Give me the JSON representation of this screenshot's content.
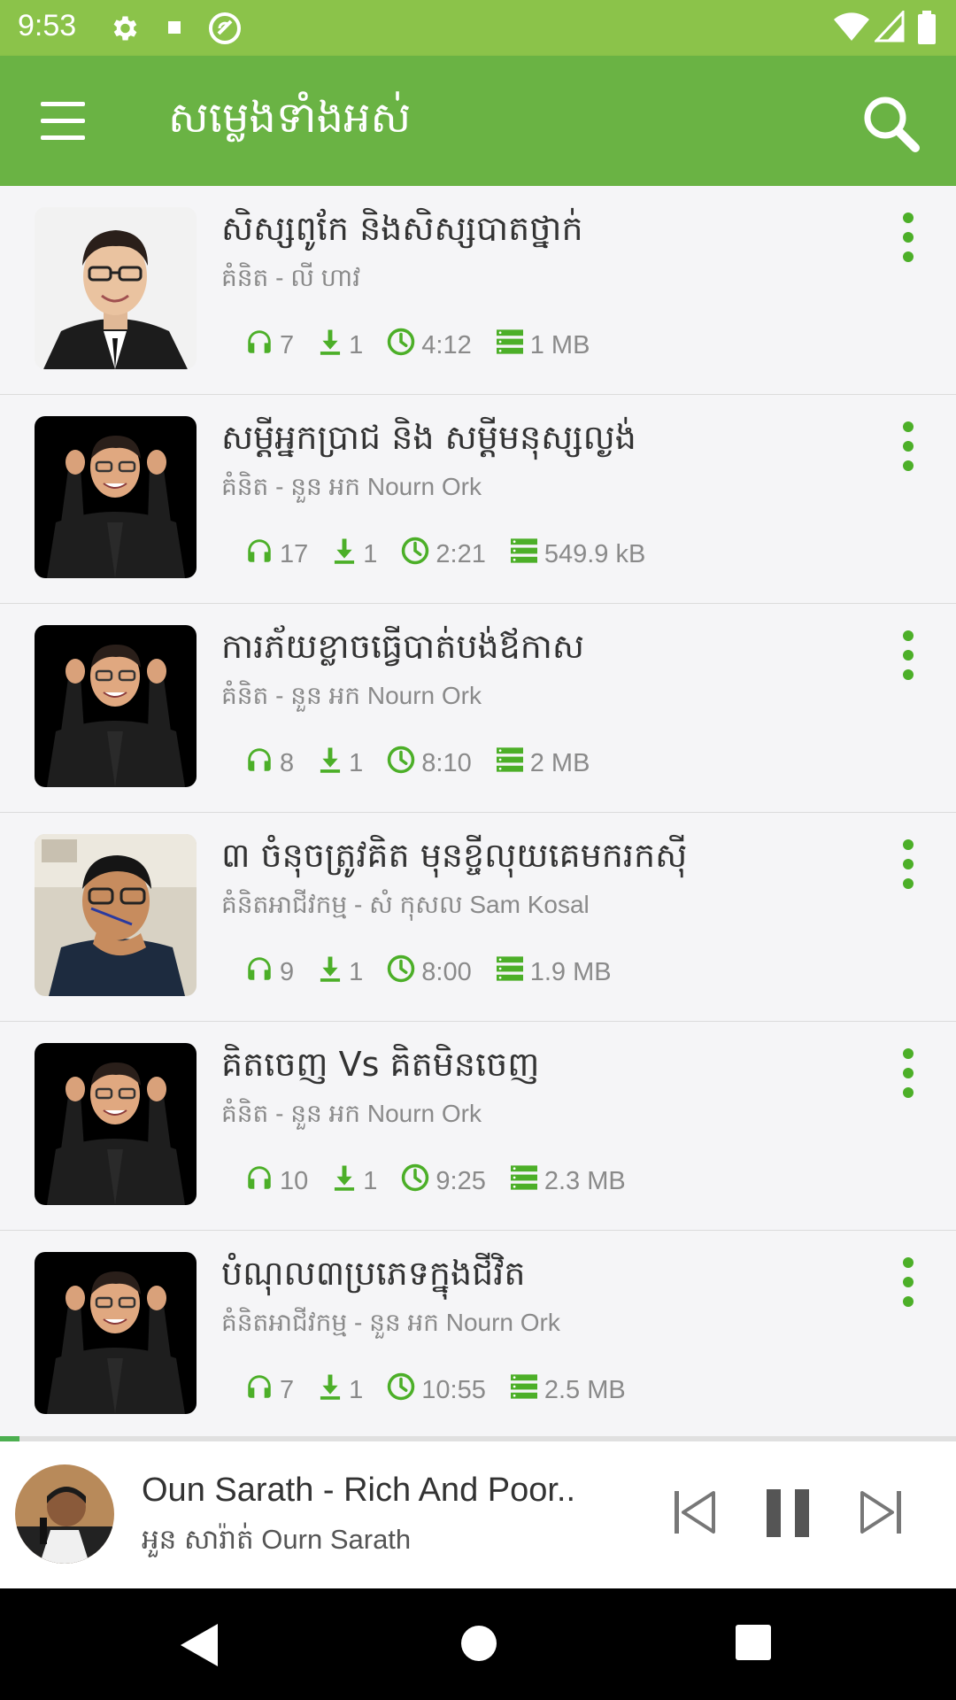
{
  "status_bar": {
    "time": "9:53"
  },
  "app_bar": {
    "title": "សម្លេងទាំងអស់"
  },
  "colors": {
    "accent": "#6ab344",
    "status": "#8bc34a",
    "icon_green": "#4caf28"
  },
  "tracks": [
    {
      "title": "សិស្សពូកែ និងសិស្សបាតថ្នាក់",
      "subtitle": "គំនិត - លី ហាវ",
      "listens": "7",
      "downloads": "1",
      "duration": "4:12",
      "size": "1 MB",
      "thumb": "glasses-man"
    },
    {
      "title": "សម្ដីអ្នកប្រាជ និង សម្ដីមនុស្សល្ងង់",
      "subtitle": "គំនិត - នួន អក Nourn Ork",
      "listens": "17",
      "downloads": "1",
      "duration": "2:21",
      "size": "549.9 kB",
      "thumb": "ork"
    },
    {
      "title": "ការភ័យខ្លាចធ្វើបាត់បង់ឪកាស",
      "subtitle": "គំនិត - នួន អក Nourn Ork",
      "listens": "8",
      "downloads": "1",
      "duration": "8:10",
      "size": "2 MB",
      "thumb": "ork"
    },
    {
      "title": "៣ ចំនុចត្រូវគិត មុនខ្ចីលុយគេមករកស៊ី",
      "subtitle": "គំនិតអាជីវកម្ម - សំ កុសល Sam Kosal",
      "listens": "9",
      "downloads": "1",
      "duration": "8:00",
      "size": "1.9 MB",
      "thumb": "kosal"
    },
    {
      "title": "គិតចេញ Vs គិតមិនចេញ",
      "subtitle": "គំនិត - នួន អក Nourn Ork",
      "listens": "10",
      "downloads": "1",
      "duration": "9:25",
      "size": "2.3 MB",
      "thumb": "ork"
    },
    {
      "title": "បំណុល៣ប្រភេទក្នុងជីវិត",
      "subtitle": "គំនិតអាជីវកម្ម - នួន អក Nourn Ork",
      "listens": "7",
      "downloads": "1",
      "duration": "10:55",
      "size": "2.5 MB",
      "thumb": "ork"
    }
  ],
  "player": {
    "title": "Oun Sarath - Rich And Poor..",
    "artist": "អួន សារ៉ាត់ Ourn Sarath",
    "progress": 0.02
  }
}
